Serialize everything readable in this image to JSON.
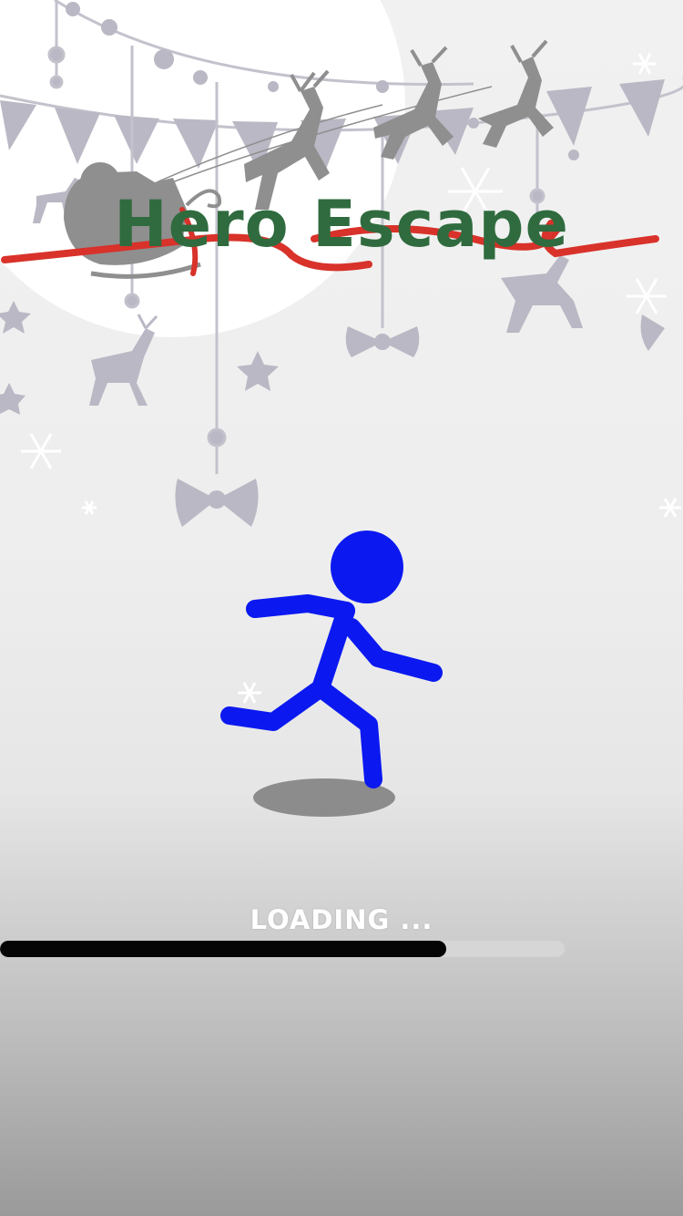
{
  "game": {
    "title": "Hero Escape",
    "loading_label": "LOADING ...",
    "loading_progress": 0.79
  },
  "colors": {
    "title": "#2f6b3e",
    "ribbon": "#d8322a",
    "decor": "#b9b8c4",
    "silhouette": "#8f8f8f",
    "hero": "#0b19f0",
    "progress_fill": "#050505",
    "progress_track": "#d6d6d6"
  },
  "icons": [
    "moon-icon",
    "bunting-icon",
    "ornament-icon",
    "star-icon",
    "bow-icon",
    "snowflake-icon",
    "reindeer-icon",
    "santa-sleigh-icon",
    "stickman-icon"
  ]
}
